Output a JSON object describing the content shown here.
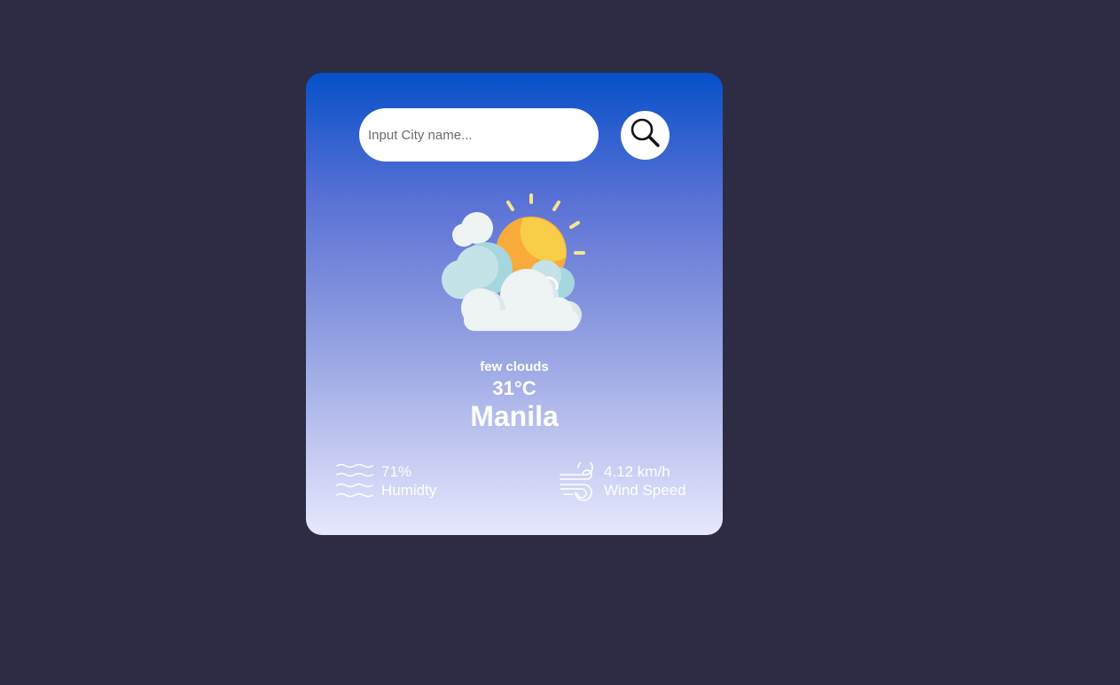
{
  "search": {
    "placeholder": "Input City name...",
    "icon": "search-icon"
  },
  "weather": {
    "icon": "sun-behind-clouds",
    "description": "few clouds",
    "temperature": "31°C",
    "city": "Manila"
  },
  "details": {
    "humidity": {
      "value": "71%",
      "label": "Humidty",
      "icon": "humidity-waves-icon"
    },
    "wind": {
      "value": "4.12 km/h",
      "label": "Wind Speed",
      "icon": "wind-icon"
    }
  },
  "colors": {
    "page_background": "#2d2c44",
    "card_gradient_top": "#0650c8",
    "card_gradient_bottom": "#e6e8fd",
    "text": "#ffffff"
  }
}
